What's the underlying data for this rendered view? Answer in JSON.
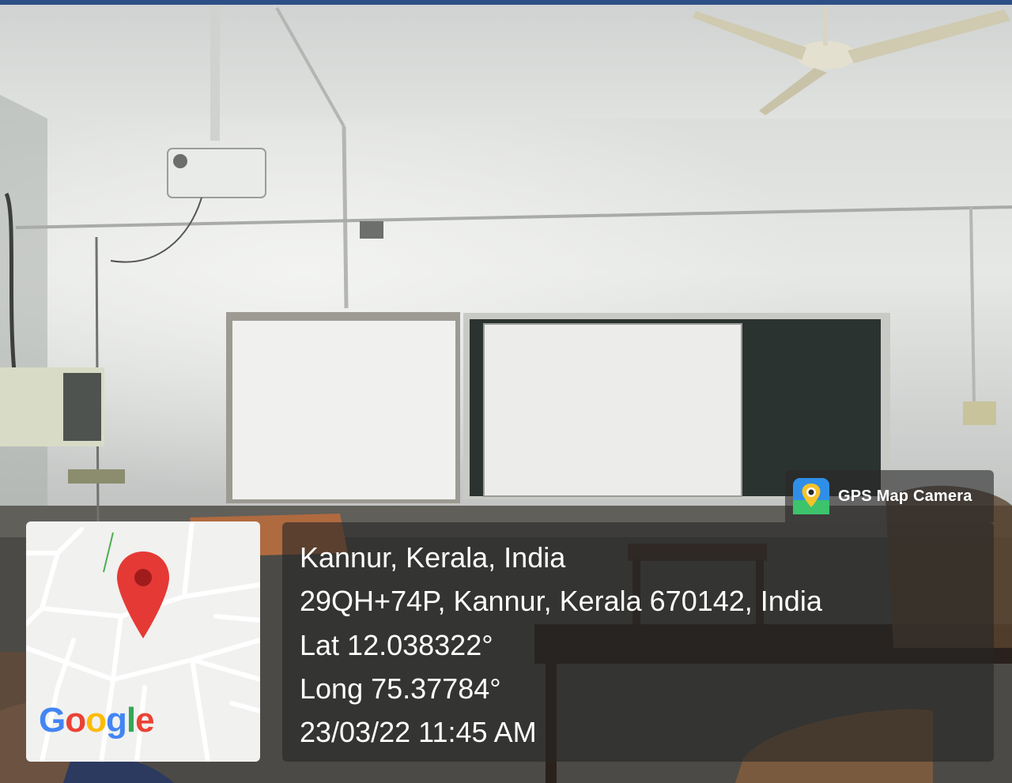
{
  "badge": {
    "label": "GPS Map Camera",
    "icon": "gps-map-camera-app-icon"
  },
  "map": {
    "logo": "Google",
    "pin_icon": "location-pin-icon",
    "pin_color": "#e53935"
  },
  "location": {
    "place": "Kannur, Kerala, India",
    "address": "29QH+74P, Kannur, Kerala 670142, India",
    "lat": "Lat 12.038322°",
    "long": "Long 75.37784°",
    "datetime": "23/03/22 11:45 AM"
  }
}
